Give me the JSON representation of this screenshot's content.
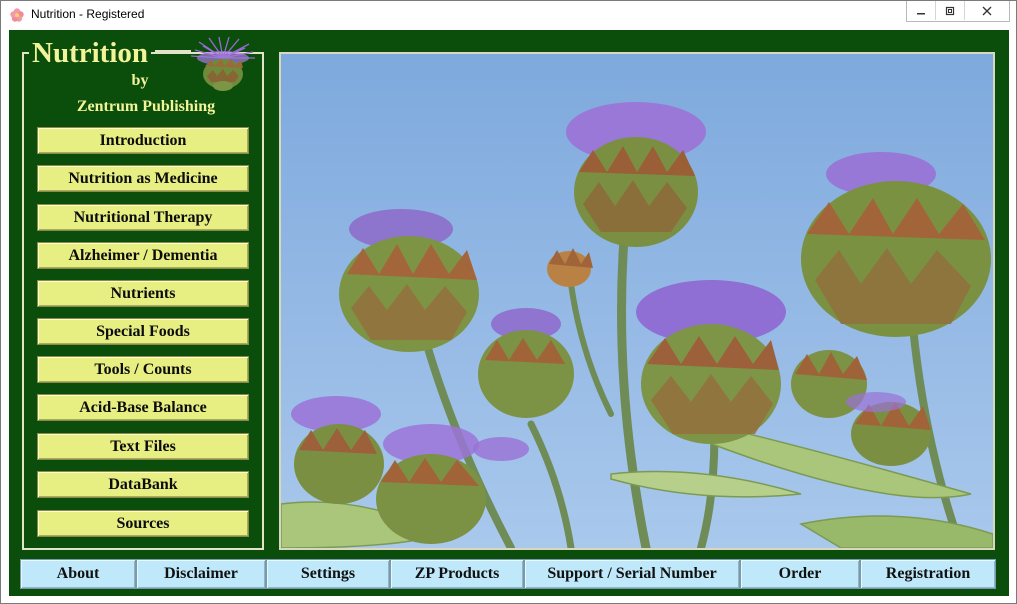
{
  "window": {
    "title": "Nutrition - Registered",
    "icons": {
      "app": "flower-app-icon",
      "minimize": "minimize-icon",
      "maximize": "restore-icon",
      "close": "close-icon"
    }
  },
  "brand": {
    "title": "Nutrition",
    "by": "by",
    "publisher": "Zentrum Publishing",
    "logo": "thistle-logo"
  },
  "menu": [
    {
      "label": "Introduction"
    },
    {
      "label": "Nutrition as Medicine"
    },
    {
      "label": "Nutritional Therapy"
    },
    {
      "label": "Alzheimer / Dementia"
    },
    {
      "label": "Nutrients"
    },
    {
      "label": "Special Foods"
    },
    {
      "label": "Tools / Counts"
    },
    {
      "label": "Acid-Base Balance"
    },
    {
      "label": "Text Files"
    },
    {
      "label": "DataBank"
    },
    {
      "label": "Sources"
    }
  ],
  "bottom_nav": [
    {
      "label": "About"
    },
    {
      "label": "Disclaimer"
    },
    {
      "label": "Settings"
    },
    {
      "label": "ZP Products"
    },
    {
      "label": "Support / Serial Number"
    },
    {
      "label": "Order"
    },
    {
      "label": "Registration"
    }
  ],
  "colors": {
    "background": "#0b4d0b",
    "brand_text": "#f3f39a",
    "menu_button": "#e7ef82",
    "bottom_button": "#bfe9fb",
    "sky": "#8fb8e6"
  }
}
